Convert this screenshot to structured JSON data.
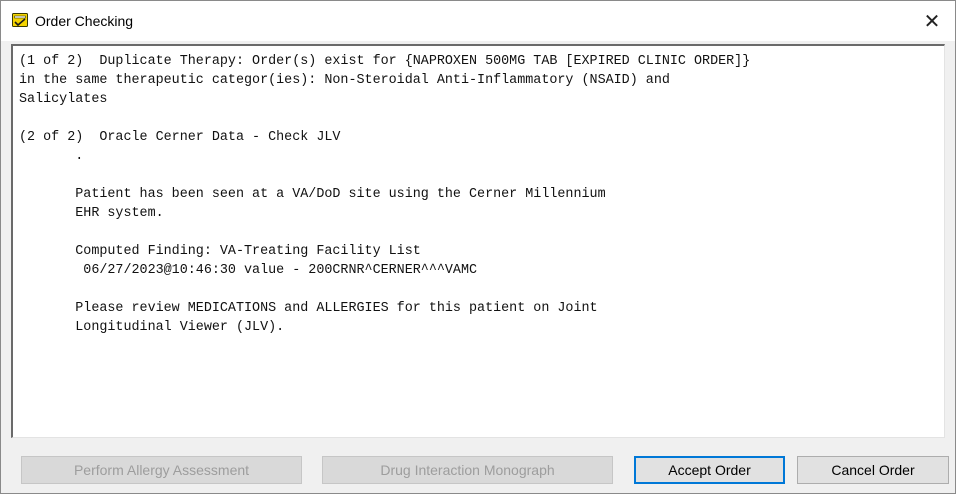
{
  "window": {
    "title": "Order Checking",
    "close_glyph": "✕",
    "title_icon": "order-check-icon"
  },
  "message": {
    "text": "(1 of 2)  Duplicate Therapy: Order(s) exist for {NAPROXEN 500MG TAB [EXPIRED CLINIC ORDER]}\nin the same therapeutic categor(ies): Non-Steroidal Anti-Inflammatory (NSAID) and\nSalicylates\n\n(2 of 2)  Oracle Cerner Data - Check JLV\n       .\n\n       Patient has been seen at a VA/DoD site using the Cerner Millennium\n       EHR system.\n\n       Computed Finding: VA-Treating Facility List\n        06/27/2023@10:46:30 value - 200CRNR^CERNER^^^VAMC\n\n       Please review MEDICATIONS and ALLERGIES for this patient on Joint\n       Longitudinal Viewer (JLV)."
  },
  "buttons": {
    "allergy": "Perform Allergy Assessment",
    "monograph": "Drug Interaction Monograph",
    "accept": "Accept Order",
    "cancel": "Cancel Order"
  },
  "colors": {
    "icon_yellow": "#f5d400",
    "focus_blue": "#0078d7"
  }
}
